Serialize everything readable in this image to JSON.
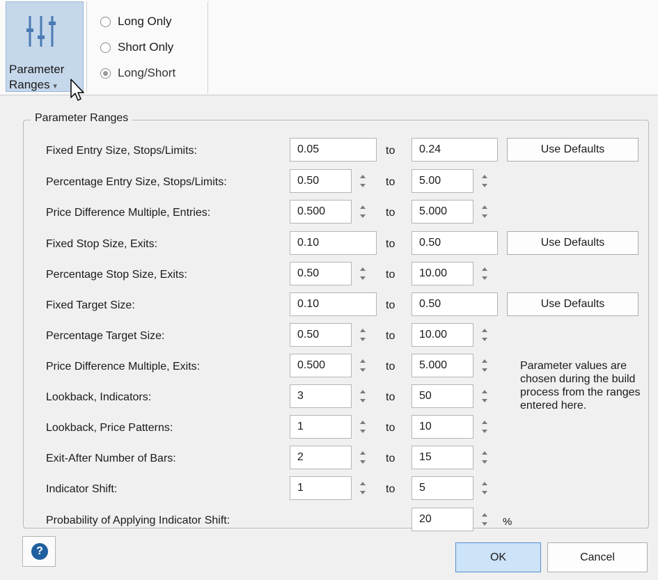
{
  "ribbon": {
    "button_label_line1": "Parameter",
    "button_label_line2": "Ranges",
    "dropdown_glyph": "▾",
    "radios": [
      {
        "label": "Long Only",
        "checked": false
      },
      {
        "label": "Short Only",
        "checked": false
      },
      {
        "label": "Long/Short",
        "checked": true
      }
    ]
  },
  "group": {
    "title": "Parameter Ranges"
  },
  "to_label": "to",
  "rows": [
    {
      "label": "Fixed Entry Size, Stops/Limits:",
      "from": "0.05",
      "to": "0.24",
      "spinner": false,
      "defaults": "Use Defaults"
    },
    {
      "label": "Percentage Entry Size, Stops/Limits:",
      "from": "0.50",
      "to": "5.00",
      "spinner": true
    },
    {
      "label": "Price Difference Multiple, Entries:",
      "from": "0.500",
      "to": "5.000",
      "spinner": true
    },
    {
      "label": "Fixed Stop Size, Exits:",
      "from": "0.10",
      "to": "0.50",
      "spinner": false,
      "defaults": "Use Defaults"
    },
    {
      "label": "Percentage Stop Size, Exits:",
      "from": "0.50",
      "to": "10.00",
      "spinner": true
    },
    {
      "label": "Fixed Target Size:",
      "from": "0.10",
      "to": "0.50",
      "spinner": false,
      "defaults": "Use Defaults"
    },
    {
      "label": "Percentage Target Size:",
      "from": "0.50",
      "to": "10.00",
      "spinner": true
    },
    {
      "label": "Price Difference Multiple, Exits:",
      "from": "0.500",
      "to": "5.000",
      "spinner": true
    },
    {
      "label": "Lookback, Indicators:",
      "from": "3",
      "to": "50",
      "spinner": true
    },
    {
      "label": "Lookback, Price Patterns:",
      "from": "1",
      "to": "10",
      "spinner": true
    },
    {
      "label": "Exit-After Number of Bars:",
      "from": "2",
      "to": "15",
      "spinner": true
    },
    {
      "label": "Indicator Shift:",
      "from": "1",
      "to": "5",
      "spinner": true
    }
  ],
  "probability": {
    "label": "Probability of Applying Indicator Shift:",
    "value": "20",
    "unit": "%"
  },
  "note": "Parameter values are chosen during the build process from the ranges entered here.",
  "footer": {
    "help_glyph": "?",
    "ok_label": "OK",
    "cancel_label": "Cancel"
  }
}
